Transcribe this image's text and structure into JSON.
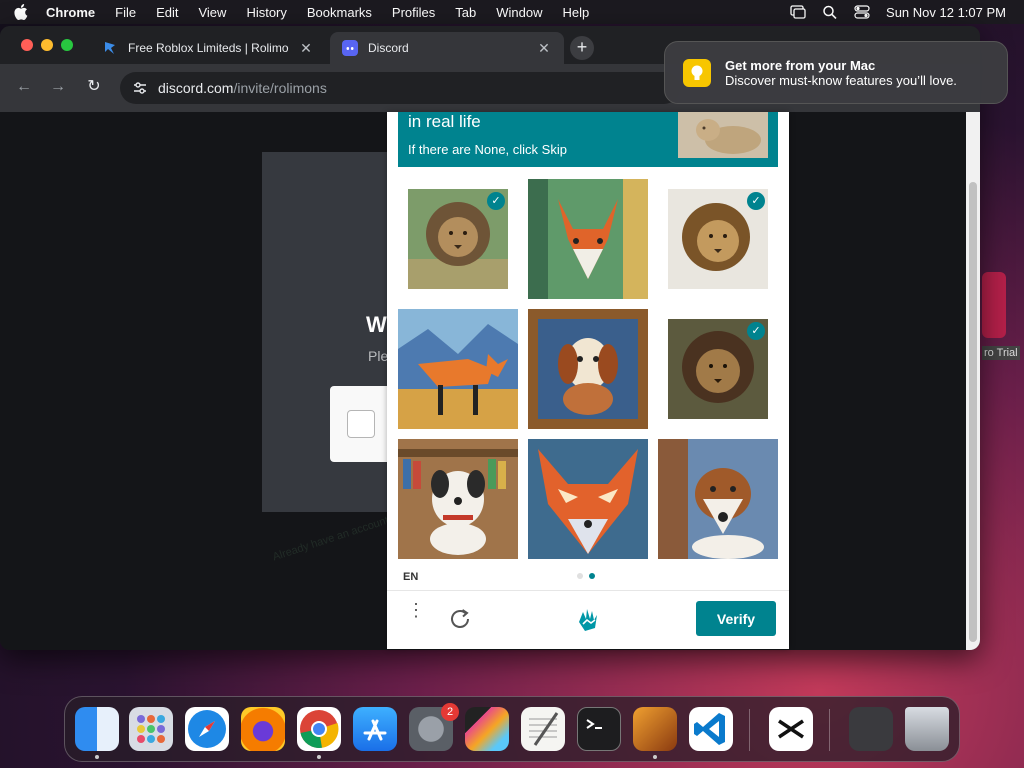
{
  "menubar": {
    "app": "Chrome",
    "items": [
      "File",
      "Edit",
      "View",
      "History",
      "Bookmarks",
      "Profiles",
      "Tab",
      "Window",
      "Help"
    ],
    "clock": "Sun Nov 12  1:07 PM"
  },
  "browser": {
    "tabs": [
      {
        "title": "Free Roblox Limiteds | Rolimo",
        "favicon": "rolimons-icon"
      },
      {
        "title": "Discord",
        "favicon": "discord-icon"
      }
    ],
    "url_host": "discord.com",
    "url_path": "/invite/rolimons"
  },
  "page": {
    "modal_title": "W",
    "modal_sub": "Ple",
    "bg_texts": [
      "Already have an account?"
    ]
  },
  "captcha": {
    "prompt": "in real life",
    "hint": "If there are None, click Skip",
    "language": "EN",
    "verify_label": "Verify",
    "tiles": [
      {
        "subject": "lion",
        "selected": true
      },
      {
        "subject": "fox painting",
        "selected": false
      },
      {
        "subject": "lion",
        "selected": true
      },
      {
        "subject": "fox painting",
        "selected": false
      },
      {
        "subject": "dog painting",
        "selected": false
      },
      {
        "subject": "lion",
        "selected": true
      },
      {
        "subject": "dog painting",
        "selected": false
      },
      {
        "subject": "fox painting",
        "selected": false
      },
      {
        "subject": "dog painting",
        "selected": false
      }
    ],
    "check_glyph": "✓"
  },
  "notification": {
    "title": "Get more from your Mac",
    "body": "Discover must-know features you’ll love."
  },
  "desktop": {
    "label": "ro Trial"
  },
  "dock": {
    "apps": [
      "Finder",
      "Launchpad",
      "Safari",
      "Firefox",
      "Chrome",
      "App Store",
      "System Settings",
      "Final Cut Pro",
      "TextEdit",
      "Terminal",
      "GarageBand",
      "VS Code",
      "CapCut",
      "Downloads",
      "Trash"
    ],
    "settings_badge": "2"
  },
  "colors": {
    "accent": "#00838f",
    "verify_bg": "#00838f"
  }
}
